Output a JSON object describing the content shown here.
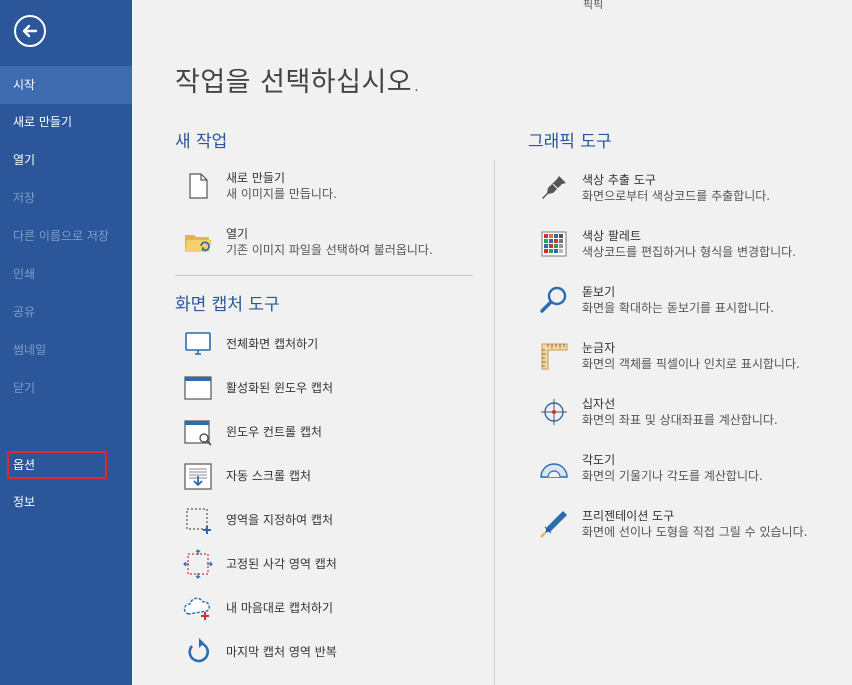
{
  "window": {
    "title": "픽픽"
  },
  "sidebar": {
    "items": [
      {
        "label": "시작"
      },
      {
        "label": "새로 만들기"
      },
      {
        "label": "열기"
      },
      {
        "label": "저장"
      },
      {
        "label": "다른 이름으로 저장"
      },
      {
        "label": "인쇄"
      },
      {
        "label": "공유"
      },
      {
        "label": "썸네일"
      },
      {
        "label": "닫기"
      },
      {
        "label": "옵션"
      },
      {
        "label": "정보"
      }
    ]
  },
  "main": {
    "title": "작업을 선택하십시오.",
    "new_task": {
      "title": "새 작업",
      "items": [
        {
          "title": "새로 만들기",
          "desc": "새 이미지를 만듭니다."
        },
        {
          "title": "열기",
          "desc": "기존 이미지 파일을 선택하여 불러옵니다."
        }
      ]
    },
    "capture": {
      "title": "화면 캡처 도구",
      "items": [
        {
          "title": "전체화면 캡처하기"
        },
        {
          "title": "활성화된 윈도우 캡처"
        },
        {
          "title": "윈도우 컨트롤 캡처"
        },
        {
          "title": "자동 스크롤 캡처"
        },
        {
          "title": "영역을 지정하여 캡처"
        },
        {
          "title": "고정된 사각 영역 캡처"
        },
        {
          "title": "내 마음대로 캡처하기"
        },
        {
          "title": "마지막 캡처 영역 반복"
        }
      ]
    },
    "graphic": {
      "title": "그래픽 도구",
      "items": [
        {
          "title": "색상 추출 도구",
          "desc": "화면으로부터 색상코드를 추출합니다."
        },
        {
          "title": "색상 팔레트",
          "desc": "색상코드를 편집하거나 형식을 변경합니다."
        },
        {
          "title": "돋보기",
          "desc": "화면을 확대하는 돋보기를 표시합니다."
        },
        {
          "title": "눈금자",
          "desc": "화면의 객체를 픽셀이나 인치로 표시합니다."
        },
        {
          "title": "십자선",
          "desc": "화면의 좌표 및 상대좌표를 계산합니다."
        },
        {
          "title": "각도기",
          "desc": "화면의 기울기나 각도를 계산합니다."
        },
        {
          "title": "프리젠테이션 도구",
          "desc": "화면에 선이나 도형을 직접 그릴 수 있습니다."
        }
      ]
    }
  },
  "colors": {
    "sidebar": "#2b579a",
    "accent": "#2b579a",
    "highlight": "#e0262e"
  }
}
